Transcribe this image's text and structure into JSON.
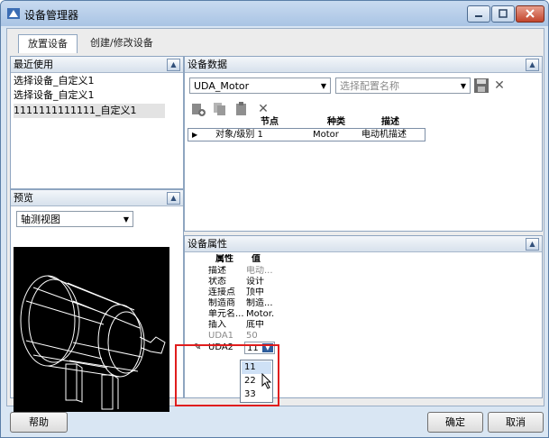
{
  "window": {
    "title": "设备管理器"
  },
  "tabs": [
    {
      "label": "放置设备",
      "active": true
    },
    {
      "label": "创建/修改设备",
      "active": false
    }
  ],
  "recent": {
    "title": "最近使用",
    "items": [
      "选择设备_自定义1",
      "选择设备_自定义1",
      "1111111111111_自定义1"
    ]
  },
  "preview": {
    "title": "预览",
    "view_select": "轴测视图"
  },
  "device_data": {
    "title": "设备数据",
    "device_select": "UDA_Motor",
    "config_placeholder": "选择配置名称",
    "columns": [
      "节点",
      "种类",
      "描述"
    ],
    "row": {
      "node": "对象/级别 1",
      "kind": "Motor",
      "desc": "电动机描述"
    }
  },
  "properties": {
    "title": "设备属性",
    "col_attr": "属性",
    "col_value": "值",
    "rows": [
      {
        "name": "描述",
        "value": "电动..."
      },
      {
        "name": "状态",
        "value": "设计"
      },
      {
        "name": "连接点",
        "value": "顶中"
      },
      {
        "name": "制造商",
        "value": "制造..."
      },
      {
        "name": "单元名...",
        "value": "Motor..."
      },
      {
        "name": "插入",
        "value": "底中"
      },
      {
        "name": "UDA1",
        "value": "50"
      }
    ],
    "edit_row": {
      "name": "UDA2",
      "value": "11"
    },
    "dropdown_options": [
      "11",
      "22",
      "33"
    ]
  },
  "buttons": {
    "help": "帮助",
    "ok": "确定",
    "cancel": "取消"
  },
  "colors": {
    "highlight": "#e01d1d",
    "title_bar": "#a9c4e4"
  }
}
